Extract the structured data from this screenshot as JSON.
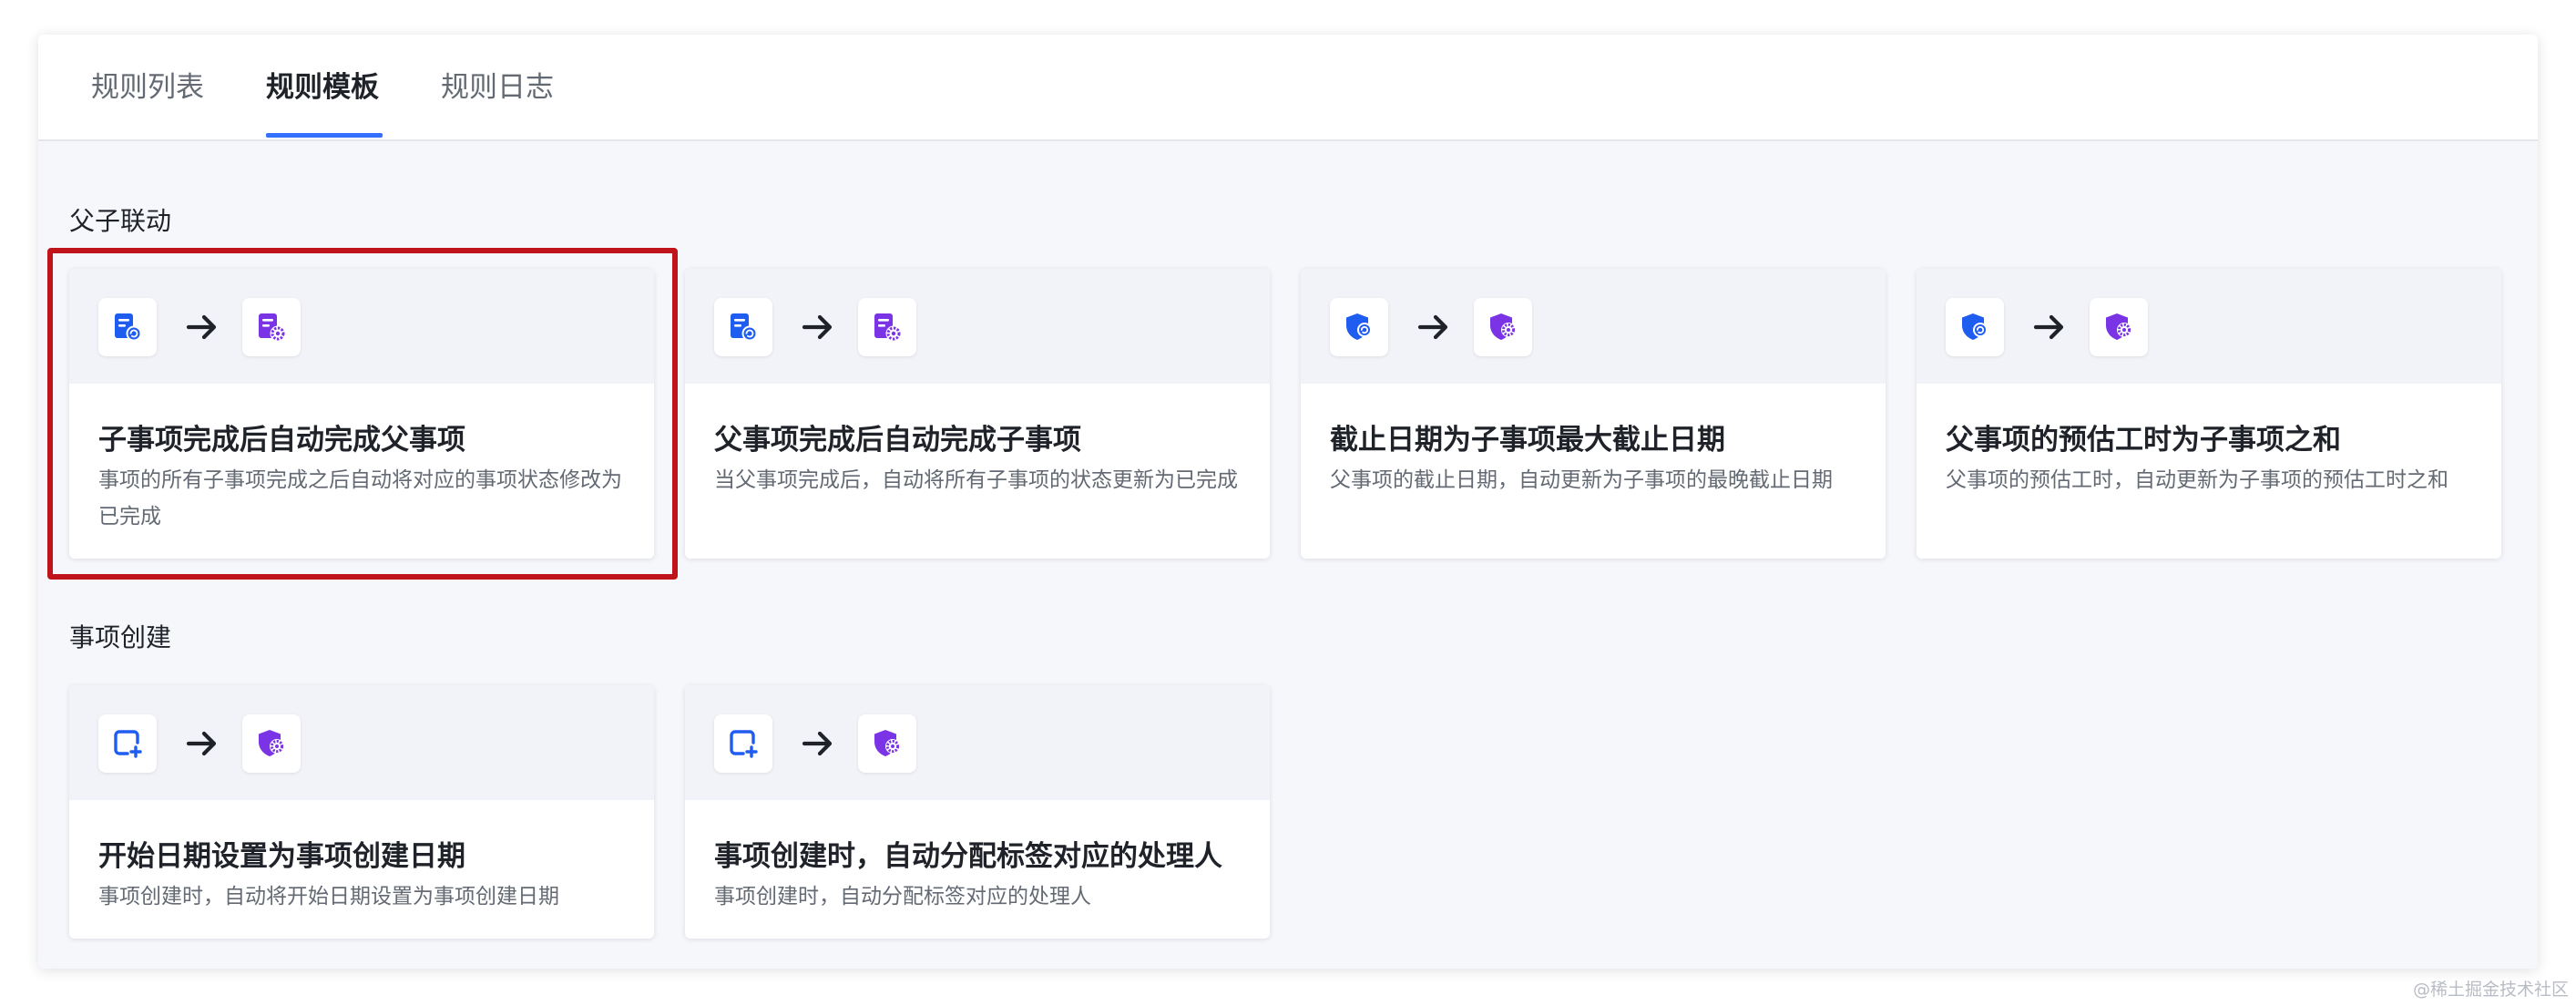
{
  "tabs": [
    {
      "label": "规则列表",
      "active": false
    },
    {
      "label": "规则模板",
      "active": true
    },
    {
      "label": "规则日志",
      "active": false
    }
  ],
  "sections": [
    {
      "title": "父子联动",
      "cards": [
        {
          "title": "子事项完成后自动完成父事项",
          "desc": "事项的所有子事项完成之后自动将对应的事项状态修改为已完成",
          "src_icon": "document-refresh-icon",
          "dst_icon": "document-gear-icon",
          "highlighted": true
        },
        {
          "title": "父事项完成后自动完成子事项",
          "desc": "当父事项完成后，自动将所有子事项的状态更新为已完成",
          "src_icon": "document-refresh-icon",
          "dst_icon": "document-gear-icon",
          "highlighted": false
        },
        {
          "title": "截止日期为子事项最大截止日期",
          "desc": "父事项的截止日期，自动更新为子事项的最晚截止日期",
          "src_icon": "shield-refresh-icon",
          "dst_icon": "shield-gear-icon",
          "highlighted": false
        },
        {
          "title": "父事项的预估工时为子事项之和",
          "desc": "父事项的预估工时，自动更新为子事项的预估工时之和",
          "src_icon": "shield-refresh-icon",
          "dst_icon": "shield-gear-icon",
          "highlighted": false
        }
      ]
    },
    {
      "title": "事项创建",
      "cards": [
        {
          "title": "开始日期设置为事项创建日期",
          "desc": "事项创建时，自动将开始日期设置为事项创建日期",
          "src_icon": "add-item-icon",
          "dst_icon": "shield-gear-icon",
          "highlighted": false
        },
        {
          "title": "事项创建时，自动分配标签对应的处理人",
          "desc": "事项创建时，自动分配标签对应的处理人",
          "src_icon": "add-item-icon",
          "dst_icon": "shield-gear-icon",
          "highlighted": false
        }
      ]
    }
  ],
  "watermark": "@稀土掘金技术社区",
  "colors": {
    "accent_blue": "#3370ff",
    "icon_blue": "#1f5cf0",
    "icon_purple": "#7b33e6",
    "highlight_red": "#c0141c"
  }
}
